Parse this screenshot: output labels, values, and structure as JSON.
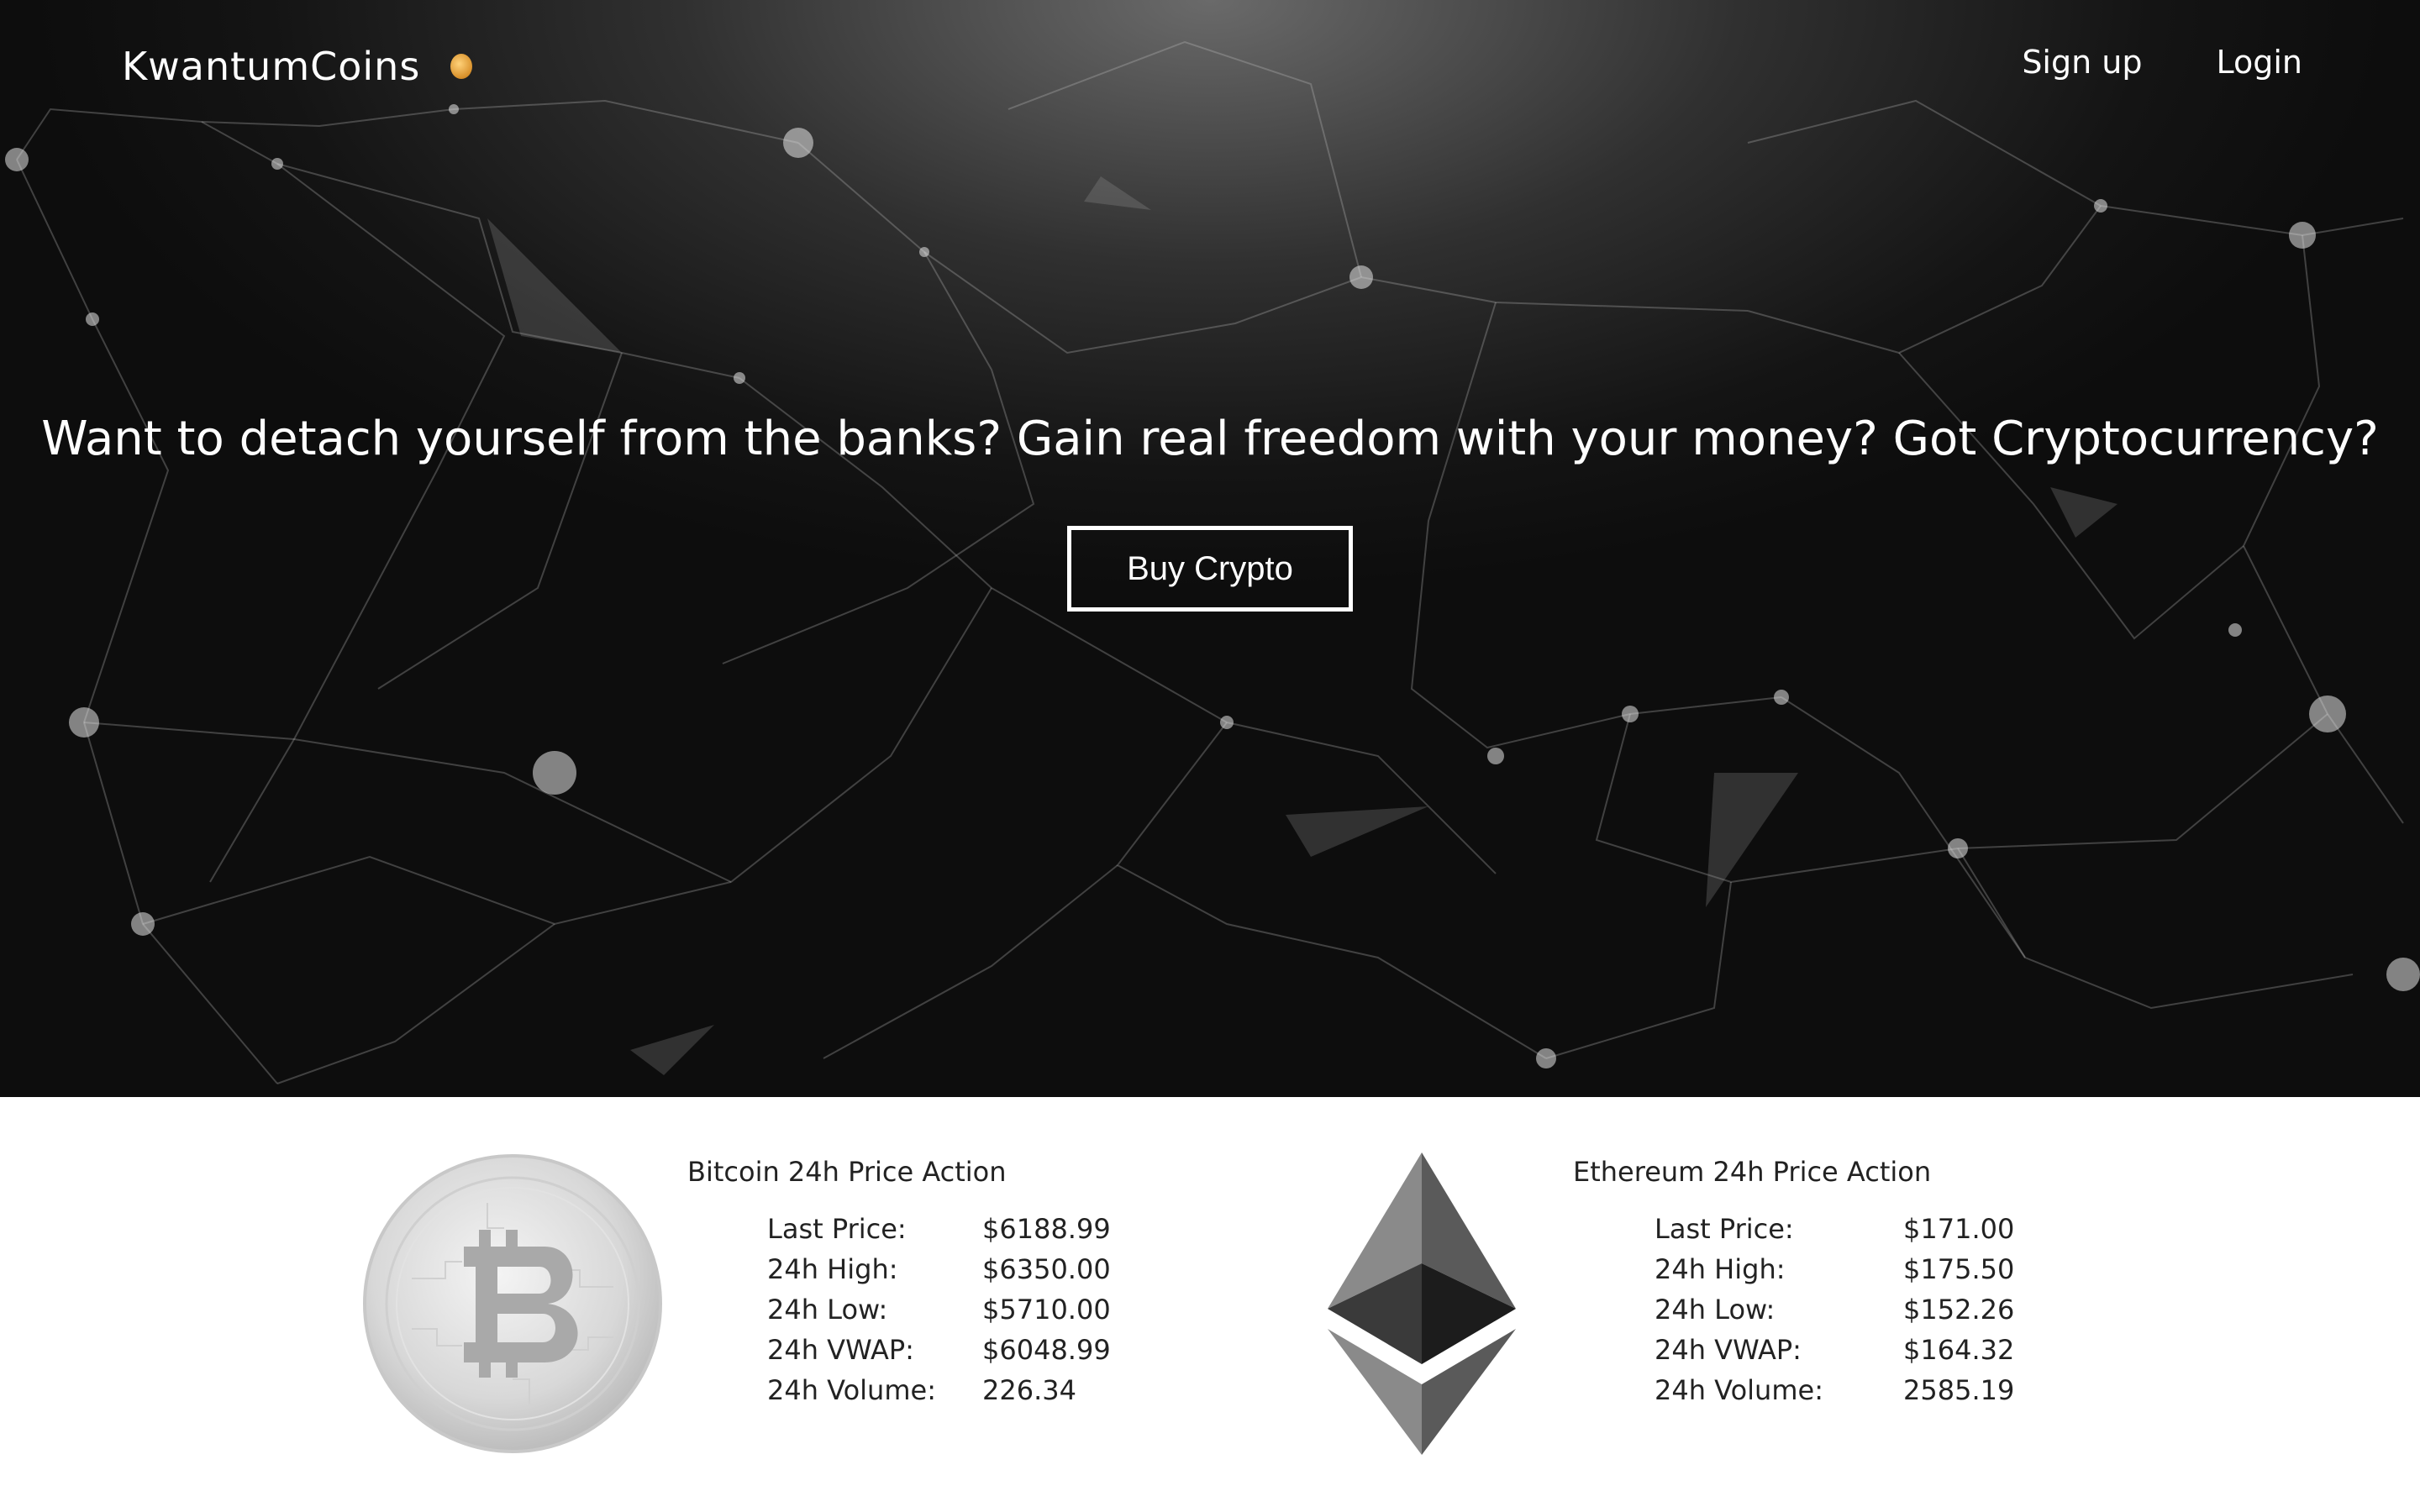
{
  "header": {
    "brand": "KwantumCoins",
    "nav": [
      {
        "label": "Sign up"
      },
      {
        "label": "Login"
      }
    ]
  },
  "hero": {
    "tagline": "Want to detach yourself from the banks? Gain real freedom with your money? Got Cryptocurrency?",
    "cta_label": "Buy Crypto"
  },
  "coins": [
    {
      "title": "Bitcoin 24h Price Action",
      "icon": "bitcoin-icon",
      "stats": [
        {
          "label": "Last Price:",
          "value": "$6188.99"
        },
        {
          "label": "24h High:",
          "value": "$6350.00"
        },
        {
          "label": "24h Low:",
          "value": "$5710.00"
        },
        {
          "label": "24h VWAP:",
          "value": "$6048.99"
        },
        {
          "label": "24h Volume:",
          "value": "226.34"
        }
      ]
    },
    {
      "title": "Ethereum 24h Price Action",
      "icon": "ethereum-icon",
      "stats": [
        {
          "label": "Last Price:",
          "value": "$171.00"
        },
        {
          "label": "24h High:",
          "value": "$175.50"
        },
        {
          "label": "24h Low:",
          "value": "$152.26"
        },
        {
          "label": "24h VWAP:",
          "value": "$164.32"
        },
        {
          "label": "24h Volume:",
          "value": "2585.19"
        }
      ]
    }
  ]
}
